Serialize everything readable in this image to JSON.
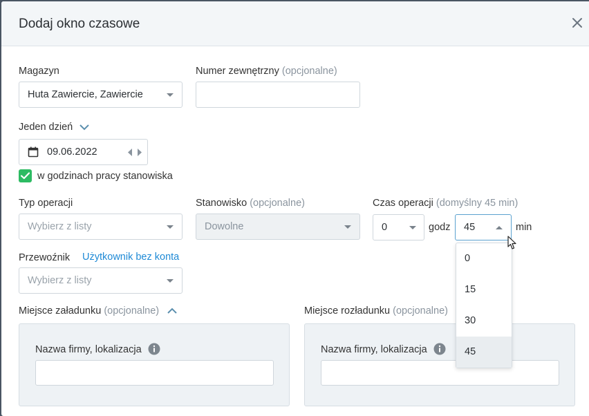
{
  "modal": {
    "title": "Dodaj okno czasowe"
  },
  "form": {
    "magazyn": {
      "label": "Magazyn",
      "value": "Huta Zawiercie, Zawiercie"
    },
    "numer": {
      "label": "Numer zewnętrzny",
      "optional": "(opcjonalne)",
      "value": ""
    },
    "jeden_dzien": {
      "label": "Jeden dzień",
      "date": "09.06.2022"
    },
    "godziny": {
      "label": "w godzinach pracy stanowiska",
      "checked": true
    },
    "typ": {
      "label": "Typ operacji",
      "placeholder": "Wybierz z listy"
    },
    "stanowisko": {
      "label": "Stanowisko",
      "optional": "(opcjonalne)",
      "value": "Dowolne"
    },
    "czas": {
      "label": "Czas operacji",
      "optional": "(domyślny 45 min)",
      "hours": "0",
      "hours_unit": "godz",
      "minutes": "45",
      "minutes_unit": "min",
      "minute_options": [
        "0",
        "15",
        "30",
        "45"
      ],
      "selected_minute": "45"
    },
    "przewoznik": {
      "label": "Przewoźnik",
      "link": "Użytkownik bez konta",
      "placeholder": "Wybierz z listy"
    },
    "zaladunek": {
      "label": "Miejsce załadunku",
      "optional": "(opcjonalne)",
      "field_label": "Nazwa firmy, lokalizacja"
    },
    "rozladunek": {
      "label": "Miejsce rozładunku",
      "optional": "(opcjonalne)",
      "field_label": "Nazwa firmy, lokalizacja"
    }
  },
  "colors": {
    "accent_link": "#1f8ad6",
    "checkbox": "#2dbb63",
    "muted": "#8a949e"
  }
}
